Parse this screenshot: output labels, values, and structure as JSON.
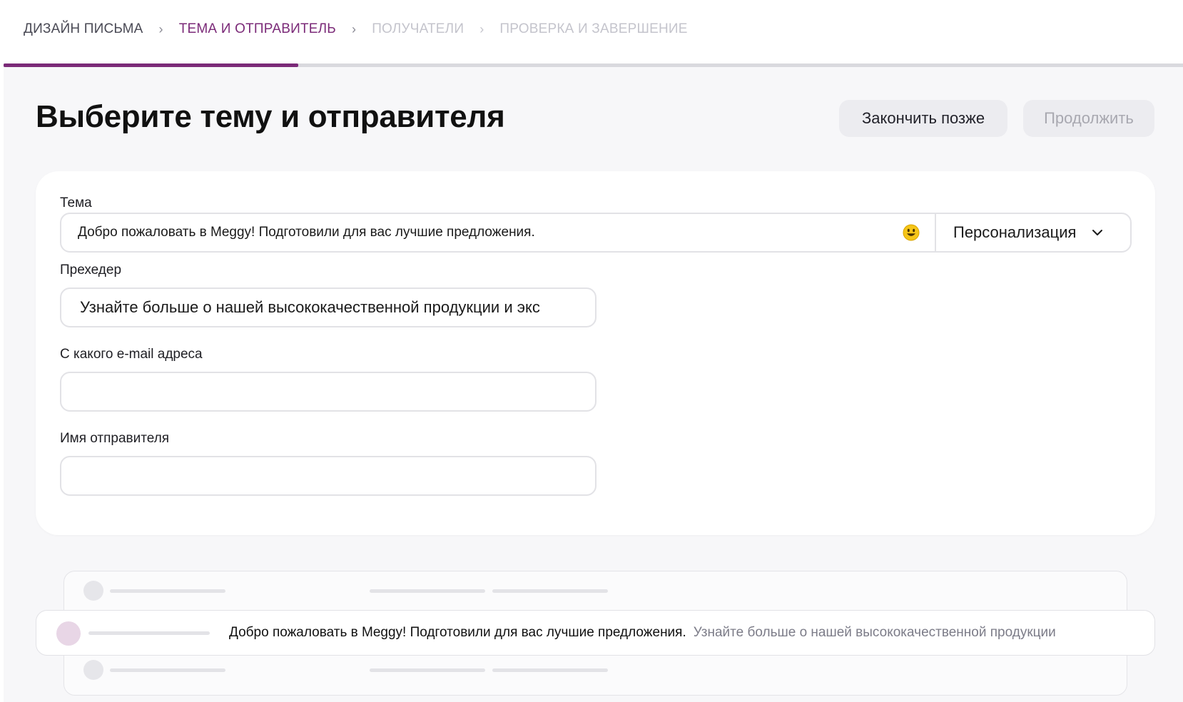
{
  "stepper": {
    "steps": [
      {
        "label": "ДИЗАЙН ПИСЬМА",
        "state": "done"
      },
      {
        "label": "ТЕМА И ОТПРАВИТЕЛЬ",
        "state": "active"
      },
      {
        "label": "ПОЛУЧАТЕЛИ",
        "state": "pending"
      },
      {
        "label": "ПРОВЕРКА И ЗАВЕРШЕНИЕ",
        "state": "pending"
      }
    ],
    "separator_icon": "chevron-right-icon",
    "progress_fraction": 0.25,
    "accent_color": "#7b2a78"
  },
  "header": {
    "title": "Выберите тему и отправителя",
    "finish_later_label": "Закончить позже",
    "continue_label": "Продолжить"
  },
  "form": {
    "subject": {
      "label": "Тема",
      "value": "Добро пожаловать в Meggy! Подготовили для вас лучшие предложения.",
      "emoji_icon": "smiley-icon",
      "personalization_label": "Персонализация",
      "dropdown_icon": "chevron-down-icon"
    },
    "preheader": {
      "label": "Прехедер",
      "value": "Узнайте больше о нашей высококачественной продукции и экс"
    },
    "from_email": {
      "label": "С какого e-mail адреса",
      "value": ""
    },
    "sender_name": {
      "label": "Имя отправителя",
      "value": ""
    }
  },
  "preview": {
    "subject": "Добро пожаловать в Meggy! Подготовили для вас лучшие предложения.",
    "preheader": "Узнайте больше о нашей высококачественной продукции"
  }
}
